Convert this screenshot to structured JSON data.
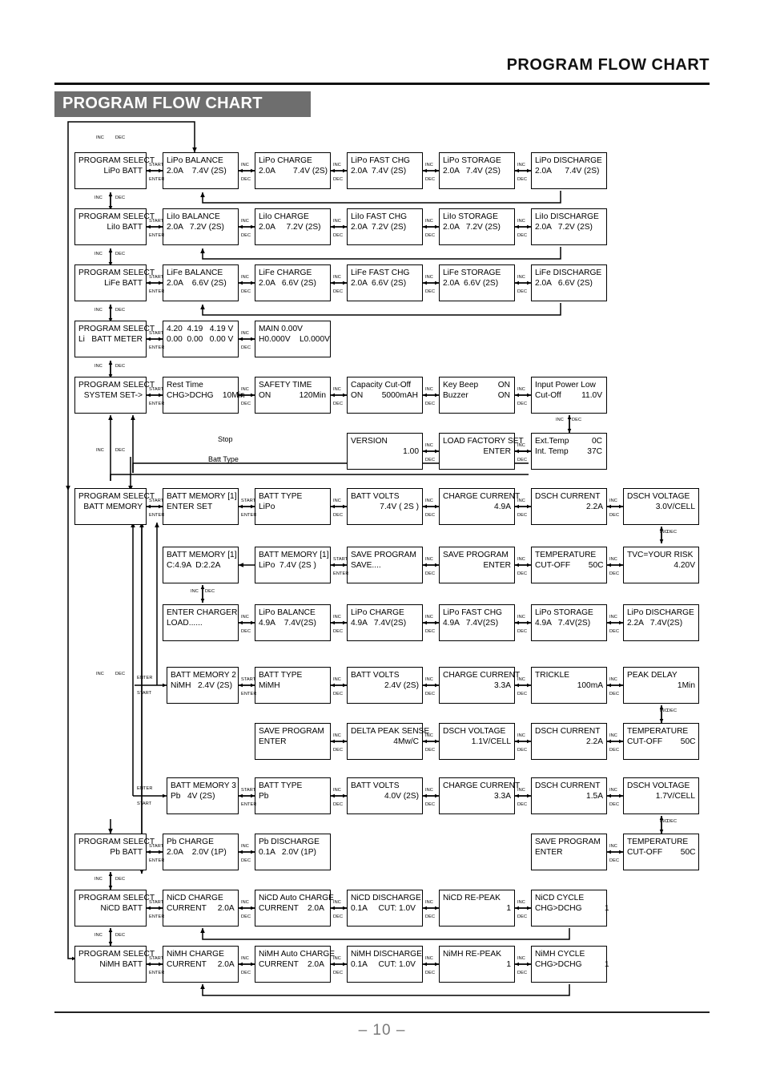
{
  "header": {
    "running_title": "PROGRAM FLOW CHART",
    "banner_title": "PROGRAM FLOW CHART"
  },
  "footer": {
    "page_label": "– 10 –"
  },
  "connector_labels": {
    "inc": "INC",
    "dec": "DEC",
    "start": "START",
    "enter": "ENTER",
    "stop": "Stop",
    "batt_type": "Batt Type"
  },
  "colors": {
    "banner_bg": "#6e6e6e",
    "banner_text": "#ffffff",
    "line": "#000000",
    "page_number": "#7a7a7a"
  },
  "chart_data": {
    "type": "diagram",
    "title": "PROGRAM FLOW CHART",
    "nodes": [
      {
        "id": "ps_lipo",
        "l1": "PROGRAM SELECT",
        "l2": "LiPo BATT",
        "align2": "right"
      },
      {
        "id": "lipo_balance",
        "l1": "LiPo BALANCE",
        "l2": "2.0A    7.4V (2S)"
      },
      {
        "id": "lipo_charge",
        "l1": "LiPo CHARGE",
        "l2": "2.0A        7.4V (2S)"
      },
      {
        "id": "lipo_fast",
        "l1": "LiPo FAST CHG",
        "l2": "2.0A  7.4V (2S)"
      },
      {
        "id": "lipo_storage",
        "l1": "LiPo STORAGE",
        "l2": "2.0A   7.4V (2S)"
      },
      {
        "id": "lipo_discharge",
        "l1": "LiPo DISCHARGE",
        "l2": "2.0A      7.4V (2S)"
      },
      {
        "id": "ps_liio",
        "l1": "PROGRAM SELECT",
        "l2": "LiIo BATT",
        "align2": "right"
      },
      {
        "id": "liio_balance",
        "l1": "LiIo BALANCE",
        "l2": "2.0A   7.2V (2S)"
      },
      {
        "id": "liio_charge",
        "l1": "LiIo CHARGE",
        "l2": "2.0A     7.2V (2S)"
      },
      {
        "id": "liio_fast",
        "l1": "LiIo FAST CHG",
        "l2": "2.0A  7.2V (2S)"
      },
      {
        "id": "liio_storage",
        "l1": "LiIo STORAGE",
        "l2": "2.0A   7.2V (2S)"
      },
      {
        "id": "liio_discharge",
        "l1": "LiIo DISCHARGE",
        "l2": "2.0A   7.2V (2S)"
      },
      {
        "id": "ps_life",
        "l1": "PROGRAM SELECT",
        "l2": "LiFe BATT",
        "align2": "right"
      },
      {
        "id": "life_balance",
        "l1": "LiFe BALANCE",
        "l2": "2.0A    6.6V (2S)"
      },
      {
        "id": "life_charge",
        "l1": "LiFe CHARGE",
        "l2": "2.0A   6.6V (2S)"
      },
      {
        "id": "life_fast",
        "l1": "LiFe FAST CHG",
        "l2": "2.0A  6.6V (2S)"
      },
      {
        "id": "life_storage",
        "l1": "LiFe STORAGE",
        "l2": "2.0A  6.6V (2S)"
      },
      {
        "id": "life_discharge",
        "l1": "LiFe DISCHARGE",
        "l2": "2.0A   6.6V (2S)"
      },
      {
        "id": "ps_meter",
        "l1": "PROGRAM SELECT",
        "l2": "Li   BATT METER",
        "align2": "right"
      },
      {
        "id": "meter_cells",
        "l1": "4.20  4.19   4.19 V",
        "l2": "0.00  0.00   0.00 V"
      },
      {
        "id": "meter_main",
        "l1": "MAIN 0.00V",
        "l2": "H0.000V    L0.000V"
      },
      {
        "id": "ps_sys",
        "l1": "PROGRAM SELECT",
        "l2": "SYSTEM SET->",
        "align2": "right"
      },
      {
        "id": "rest_time",
        "l1": "Rest Time",
        "l2": "CHG>DCHG    10Min"
      },
      {
        "id": "safety_time",
        "l1": "SAFETY TIME",
        "l2": "ON",
        "r2": "120Min"
      },
      {
        "id": "capacity",
        "l1": "Capacity Cut-Off",
        "l2": "ON",
        "r2": "5000mAH"
      },
      {
        "id": "keybeep",
        "l1": "Key Beep",
        "r1": "ON",
        "l2": "Buzzer",
        "r2": "ON"
      },
      {
        "id": "inputlow",
        "l1": "Input Power Low",
        "l2": "Cut-Off",
        "r2": "11.0V"
      },
      {
        "id": "version",
        "l1": "VERSION",
        "l2": "1.00",
        "align2": "right"
      },
      {
        "id": "factory",
        "l1": "LOAD FACTORY SET",
        "l2": "ENTER",
        "align2": "right"
      },
      {
        "id": "temps",
        "l1": "Ext.Temp",
        "r1": "0C",
        "l2": "Int. Temp",
        "r2": "37C"
      },
      {
        "id": "ps_mem",
        "l1": "PROGRAM SELECT",
        "l2": "BATT MEMORY",
        "align2": "right"
      },
      {
        "id": "mem1_enter",
        "l1": "BATT MEMORY [1]",
        "l2": "ENTER SET"
      },
      {
        "id": "mem1_type",
        "l1": "BATT TYPE",
        "l2": "LiPo"
      },
      {
        "id": "mem1_volts",
        "l1": "BATT VOLTS",
        "l2": "7.4V ( 2S )",
        "align2": "right"
      },
      {
        "id": "mem1_chgcur",
        "l1": "CHARGE CURRENT",
        "l2": "4.9A",
        "align2": "right"
      },
      {
        "id": "mem1_dschcur",
        "l1": "DSCH CURRENT",
        "l2": "2.2A",
        "align2": "right"
      },
      {
        "id": "mem1_dschvolt",
        "l1": "DSCH VOLTAGE",
        "l2": "3.0V/CELL",
        "align2": "right"
      },
      {
        "id": "mem1_cd",
        "l1": "BATT MEMORY [1]",
        "l2": "C:4.9A  D:2.2A"
      },
      {
        "id": "mem1_sum",
        "l1": "BATT MEMORY [1]",
        "l2": "LiPo  7.4V (2S )"
      },
      {
        "id": "save_saving",
        "l1": "SAVE PROGRAM",
        "l2": "SAVE...."
      },
      {
        "id": "save_enter1",
        "l1": "SAVE PROGRAM",
        "l2": "ENTER",
        "align2": "right"
      },
      {
        "id": "temp1",
        "l1": "TEMPERATURE",
        "l2": "CUT-OFF        50C"
      },
      {
        "id": "tvc",
        "l1": "TVC=YOUR RISK",
        "l2": "4.20V",
        "align2": "right"
      },
      {
        "id": "entercharger",
        "l1": "ENTER CHARGER",
        "l2": "LOAD......"
      },
      {
        "id": "m_balance",
        "l1": "LiPo BALANCE",
        "l2": "4.9A    7.4V(2S)"
      },
      {
        "id": "m_charge",
        "l1": "LiPo CHARGE",
        "l2": "4.9A   7.4V(2S)"
      },
      {
        "id": "m_fast",
        "l1": "LiPo FAST CHG",
        "l2": "4.9A   7.4V(2S)"
      },
      {
        "id": "m_storage",
        "l1": "LiPo STORAGE",
        "l2": "4.9A   7.4V(2S)"
      },
      {
        "id": "m_discharge",
        "l1": "LiPo DISCHARGE",
        "l2": "2.2A   7.4V(2S)"
      },
      {
        "id": "mem2",
        "l1": "BATT MEMORY 2",
        "l2": "NiMH   2.4V (2S)"
      },
      {
        "id": "mem2_type",
        "l1": "BATT TYPE",
        "l2": "MiMH"
      },
      {
        "id": "mem2_volts",
        "l1": "BATT VOLTS",
        "l2": "2.4V (2S)",
        "align2": "right"
      },
      {
        "id": "mem2_chgcur",
        "l1": "CHARGE CURRENT",
        "l2": "3.3A",
        "align2": "right"
      },
      {
        "id": "trickle",
        "l1": "TRICKLE",
        "l2": "100mA",
        "align2": "right"
      },
      {
        "id": "peakdelay",
        "l1": "PEAK DELAY",
        "l2": "1Min",
        "align2": "right"
      },
      {
        "id": "save_enter2",
        "l1": "SAVE PROGRAM",
        "l2": "ENTER"
      },
      {
        "id": "deltapeak",
        "l1": "DELTA PEAK SENSE",
        "l2": "4Mw/C",
        "align2": "right"
      },
      {
        "id": "mem2_dschvolt",
        "l1": "DSCH VOLTAGE",
        "l2": "1.1V/CELL",
        "align2": "right"
      },
      {
        "id": "mem2_dschcur",
        "l1": "DSCH CURRENT",
        "l2": "2.2A",
        "align2": "right"
      },
      {
        "id": "temp2",
        "l1": "TEMPERATURE",
        "l2": "CUT-OFF        50C"
      },
      {
        "id": "mem3",
        "l1": "BATT MEMORY 3",
        "l2": "Pb   4V (2S)"
      },
      {
        "id": "mem3_type",
        "l1": "BATT TYPE",
        "l2": "Pb"
      },
      {
        "id": "mem3_volts",
        "l1": "BATT VOLTS",
        "l2": "4.0V (2S)",
        "align2": "right"
      },
      {
        "id": "mem3_chgcur",
        "l1": "CHARGE CURRENT",
        "l2": "3.3A",
        "align2": "right"
      },
      {
        "id": "mem3_dschcur",
        "l1": "DSCH CURRENT",
        "l2": "1.5A",
        "align2": "right"
      },
      {
        "id": "mem3_dschvolt",
        "l1": "DSCH VOLTAGE",
        "l2": "1.7V/CELL",
        "align2": "right"
      },
      {
        "id": "ps_pb",
        "l1": "PROGRAM SELECT",
        "l2": "Pb BATT",
        "align2": "right"
      },
      {
        "id": "pb_charge",
        "l1": "Pb CHARGE",
        "l2": "2.0A    2.0V (1P)"
      },
      {
        "id": "pb_discharge",
        "l1": "Pb DISCHARGE",
        "l2": "0.1A   2.0V (1P)"
      },
      {
        "id": "save_enter3",
        "l1": "SAVE PROGRAM",
        "l2": "ENTER"
      },
      {
        "id": "temp3",
        "l1": "TEMPERATURE",
        "l2": "CUT-OFF        50C"
      },
      {
        "id": "ps_nicd",
        "l1": "PROGRAM SELECT",
        "l2": "NiCD BATT",
        "align2": "right"
      },
      {
        "id": "nicd_charge",
        "l1": "NiCD CHARGE",
        "l2": "CURRENT     2.0A"
      },
      {
        "id": "nicd_auto",
        "l1": "NiCD Auto CHARGE",
        "l2": "CURRENT    2.0A"
      },
      {
        "id": "nicd_dsch",
        "l1": "NiCD DISCHARGE",
        "l2": "0.1A     CUT: 1.0V"
      },
      {
        "id": "nicd_repeak",
        "l1": "NiCD RE-PEAK",
        "l2": "1",
        "align2": "right"
      },
      {
        "id": "nicd_cycle",
        "l1": "NiCD CYCLE",
        "l2": "CHG>DCHG          1"
      },
      {
        "id": "ps_nimh",
        "l1": "PROGRAM SELECT",
        "l2": "NiMH BATT",
        "align2": "right"
      },
      {
        "id": "nimh_charge",
        "l1": "NiMH CHARGE",
        "l2": "CURRENT     2.0A"
      },
      {
        "id": "nimh_auto",
        "l1": "NiMH Auto CHARGE",
        "l2": "CURRENT    2.0A"
      },
      {
        "id": "nimh_dsch",
        "l1": "NiMH DISCHARGE",
        "l2": "0.1A     CUT: 1.0V"
      },
      {
        "id": "nimh_repeak",
        "l1": "NiMH RE-PEAK",
        "l2": "1",
        "align2": "right"
      },
      {
        "id": "nimh_cycle",
        "l1": "NiMH CYCLE",
        "l2": "CHG>DCHG          1"
      }
    ]
  }
}
